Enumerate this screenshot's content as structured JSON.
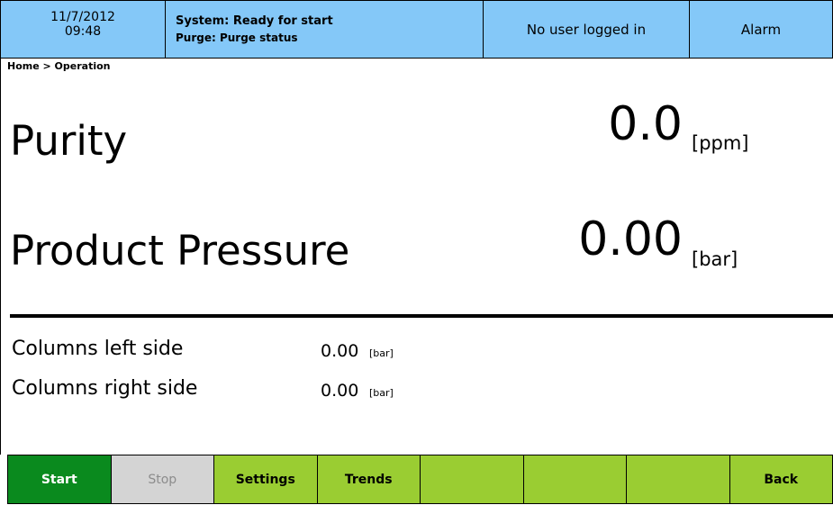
{
  "header": {
    "date": "11/7/2012",
    "time": "09:48",
    "system_status": "System: Ready for start",
    "purge_status": "Purge: Purge status",
    "user_status": "No user logged in",
    "alarm_label": "Alarm"
  },
  "breadcrumb": "Home > Operation",
  "purity": {
    "label": "Purity",
    "value": "0.0",
    "unit": "[ppm]"
  },
  "product_pressure": {
    "label": "Product Pressure",
    "value": "0.00",
    "unit": "[bar]"
  },
  "columns_left": {
    "label": "Columns left side",
    "value": "0.00",
    "unit": "[bar]"
  },
  "columns_right": {
    "label": "Columns right side",
    "value": "0.00",
    "unit": "[bar]"
  },
  "footer": {
    "start": "Start",
    "stop": "Stop",
    "settings": "Settings",
    "trends": "Trends",
    "slot5": "",
    "slot6": "",
    "slot7": "",
    "back": "Back"
  },
  "colors": {
    "header_bg": "#84c8f8",
    "start_bg": "#0a8a1e",
    "button_bg": "#9acd32",
    "disabled_bg": "#d4d4d4"
  }
}
